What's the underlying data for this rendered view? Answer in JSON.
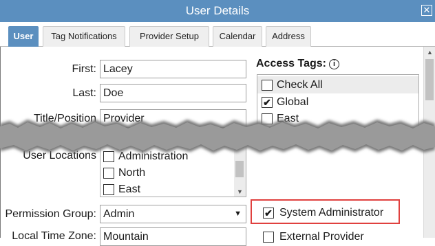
{
  "window": {
    "title": "User Details",
    "close_glyph": "✕"
  },
  "tabs": [
    {
      "label": "User",
      "active": true
    },
    {
      "label": "Tag Notifications"
    },
    {
      "label": "Provider Setup"
    },
    {
      "label": "Calendar"
    },
    {
      "label": "Address"
    }
  ],
  "form": {
    "first_label": "First:",
    "first_value": "Lacey",
    "last_label": "Last:",
    "last_value": "Doe",
    "title_label": "Title/Position",
    "title_value": "Provider",
    "locations_label": "User Locations",
    "locations": [
      {
        "label": "Administration",
        "checked": false
      },
      {
        "label": "North",
        "checked": false
      },
      {
        "label": "East",
        "checked": false
      }
    ],
    "permission_label": "Permission Group:",
    "permission_value": "Admin",
    "timezone_label": "Local Time Zone:",
    "timezone_value": "Mountain"
  },
  "access_tags": {
    "heading": "Access Tags:",
    "info_glyph": "i",
    "items": [
      {
        "label": "Check All",
        "checked": false
      },
      {
        "label": "Global",
        "checked": true
      },
      {
        "label": "East",
        "checked": false
      }
    ]
  },
  "roles": {
    "system_admin_label": "System Administrator",
    "system_admin_checked": true,
    "external_provider_label": "External Provider",
    "external_provider_checked": false
  },
  "glyphs": {
    "check": "✔",
    "arrow_down": "▼",
    "arrow_up": "▲"
  }
}
